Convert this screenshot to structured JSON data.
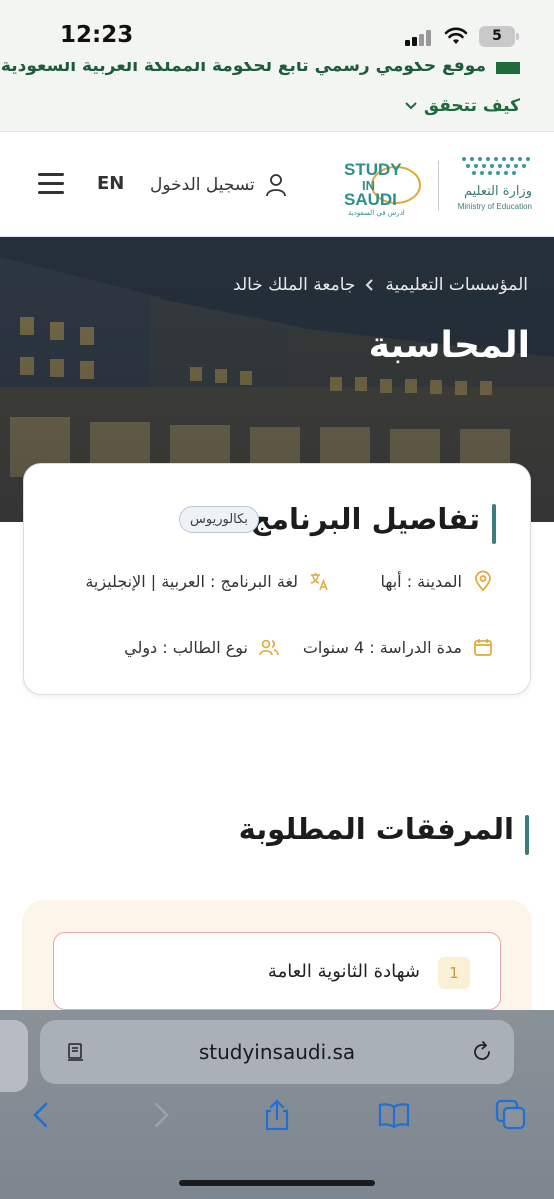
{
  "status_bar": {
    "time": "12:23",
    "battery": "5"
  },
  "gov_banner": {
    "text": "موقع حكومي رسمي تابع لحكومة المملكة العربية السعودية",
    "verify_label": "كيف تتحقق"
  },
  "header": {
    "lang_label": "EN",
    "login_label": "تسجيل الدخول",
    "study_logo": {
      "line1": "STUDY",
      "line2": "IN",
      "line3": "SAUDI",
      "tagline": "ادرس في السعودية"
    },
    "moe_logo": {
      "arabic": "وزارة التعليم",
      "english": "Ministry of Education"
    }
  },
  "hero": {
    "breadcrumb": [
      "المؤسسات التعليمية",
      "جامعة الملك خالد"
    ],
    "title": "المحاسبة"
  },
  "program_details": {
    "title": "تفاصيل البرنامج",
    "degree_badge": "بكالوريوس",
    "city": "المدينة : أبها",
    "language": "لغة البرنامج : العربية | الإنجليزية",
    "duration": "مدة الدراسة : 4 سنوات",
    "student_type": "نوع الطالب : دولي"
  },
  "attachments": {
    "title": "المرفقات المطلوبة",
    "items": [
      {
        "number": "1",
        "label": "شهادة الثانوية العامة"
      }
    ]
  },
  "browser": {
    "url": "studyinsaudi.sa"
  },
  "colors": {
    "accent": "#3a7d78",
    "gov_green": "#1d6b3a",
    "icon_gold": "#e0a93b"
  }
}
